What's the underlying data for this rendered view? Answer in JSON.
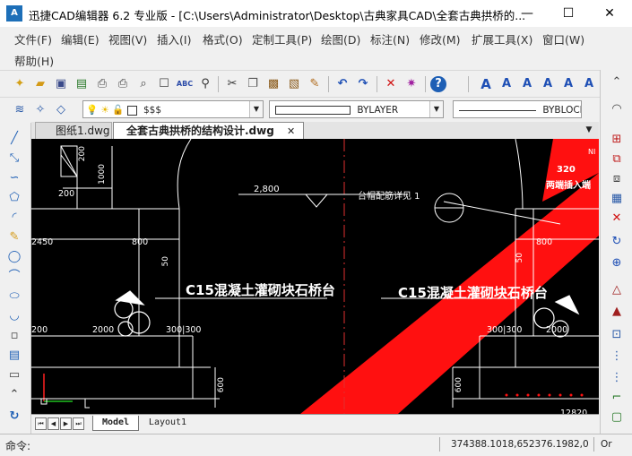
{
  "window": {
    "title": "迅捷CAD编辑器 6.2 专业版  - [C:\\Users\\Administrator\\Desktop\\古典家具CAD\\全套古典拱桥的...",
    "app_icon_text": "A",
    "minimize": "—",
    "maximize": "☐",
    "close": "✕"
  },
  "menu": {
    "items": [
      "文件(F)",
      "编辑(E)",
      "视图(V)",
      "插入(I)",
      "格式(O)",
      "定制工具(P)",
      "绘图(D)",
      "标注(N)",
      "修改(M)",
      "扩展工具(X)",
      "窗口(W)"
    ],
    "second_row": [
      "帮助(H)"
    ]
  },
  "toolbar2": {
    "layer_value": "$$$",
    "linetype_value": "BYLAYER",
    "lineweight_value": "BYBLOCK"
  },
  "tabs": [
    {
      "label": "图纸1.dwg",
      "active": false
    },
    {
      "label": "全套古典拱桥的结构设计.dwg",
      "active": true
    }
  ],
  "tab_close": "✕",
  "canvas": {
    "dim_200_top": "200",
    "dim_1000": "1000",
    "dim_200": "200",
    "elev_2800": "2,800",
    "note": "台帽配筋详见 1",
    "dim_2450": "2450",
    "dim_800_left": "800",
    "dim_800_right": "800",
    "dim_50_left": "50",
    "dim_50_right": "50",
    "label_left": "C15混凝土灌砌块石桥台",
    "label_right": "C15混凝土灌砌块石桥台",
    "dim_200_bottom_left": "200",
    "dim_2000": "2000",
    "dim_300_300_left": "300|300",
    "dim_300_300_right": "300|300",
    "dim_2000_right": "2000",
    "dim_600_left": "600",
    "dim_600_right": "600",
    "red_320": "320",
    "red_label": "两端插入端",
    "red_ni": "NI",
    "dim_12820": "12820"
  },
  "layout_tabs": [
    "Model",
    "Layout1"
  ],
  "status": {
    "command_label": "命令:",
    "coords": "374388.1018,652376.1982,0",
    "right_label": "Or"
  }
}
